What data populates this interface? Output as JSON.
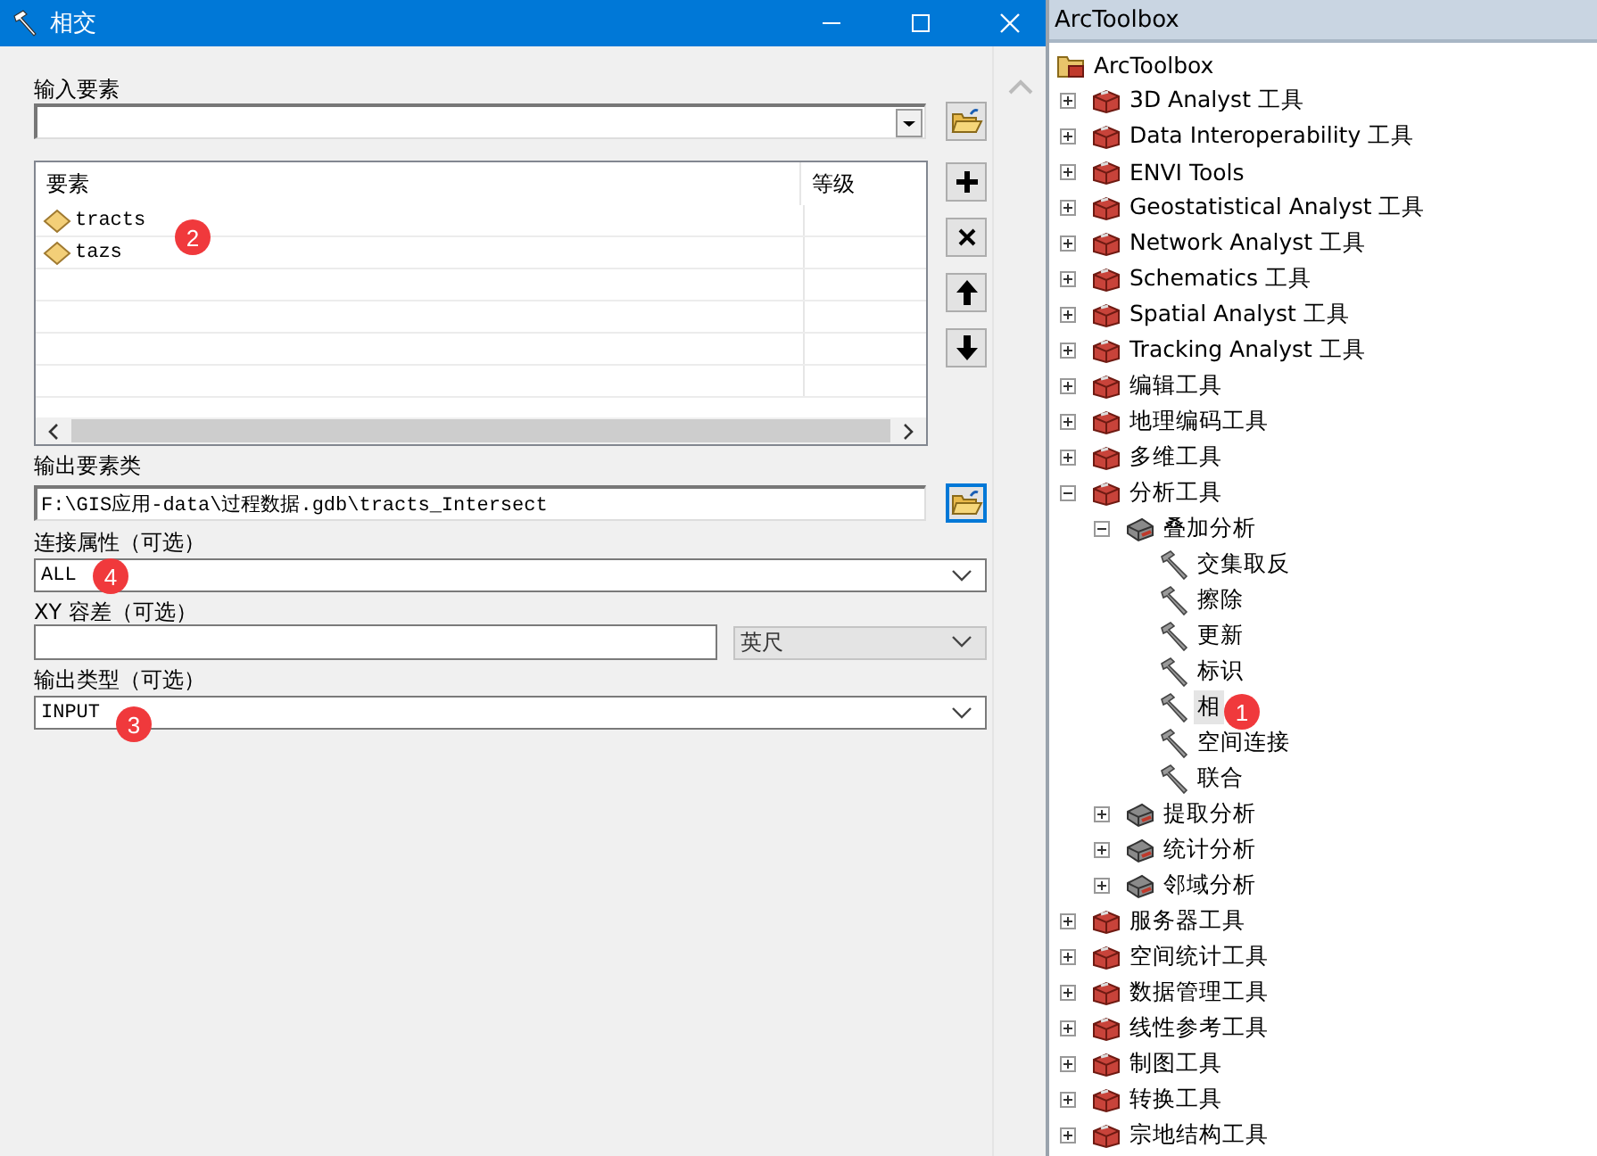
{
  "dialog": {
    "title": "相交",
    "input_features": {
      "label": "输入要素"
    },
    "features_table": {
      "columns": [
        "要素",
        "等级"
      ],
      "badge": "2",
      "rows": [
        {
          "name": "tracts"
        },
        {
          "name": "tazs"
        }
      ]
    },
    "output": {
      "label": "输出要素类",
      "value": "F:\\GIS应用-data\\过程数据.gdb\\tracts_Intersect"
    },
    "join_attributes": {
      "label": "连接属性（可选）",
      "value": "ALL",
      "badge": "4"
    },
    "xy_tolerance": {
      "label": "XY 容差（可选）",
      "unit": "英尺",
      "unit_disabled": true
    },
    "output_type": {
      "label": "输出类型（可选）",
      "value": "INPUT",
      "badge": "3"
    }
  },
  "toolbox": {
    "title": "ArcToolbox",
    "tree": [
      {
        "label": "ArcToolbox",
        "kind": "root",
        "selected": false,
        "children": [
          {
            "label": "3D Analyst 工具",
            "kind": "toolbox",
            "expanded": false,
            "selected": false
          },
          {
            "label": "Data Interoperability 工具",
            "kind": "toolbox",
            "expanded": false,
            "selected": false
          },
          {
            "label": "ENVI Tools",
            "kind": "toolbox",
            "expanded": false,
            "selected": false
          },
          {
            "label": "Geostatistical Analyst 工具",
            "kind": "toolbox",
            "expanded": false,
            "selected": false
          },
          {
            "label": "Network Analyst 工具",
            "kind": "toolbox",
            "expanded": false,
            "selected": false
          },
          {
            "label": "Schematics 工具",
            "kind": "toolbox",
            "expanded": false,
            "selected": false
          },
          {
            "label": "Spatial Analyst 工具",
            "kind": "toolbox",
            "expanded": false,
            "selected": false
          },
          {
            "label": "Tracking Analyst 工具",
            "kind": "toolbox",
            "expanded": false,
            "selected": false
          },
          {
            "label": "编辑工具",
            "kind": "toolbox",
            "expanded": false,
            "selected": false
          },
          {
            "label": "地理编码工具",
            "kind": "toolbox",
            "expanded": false,
            "selected": false
          },
          {
            "label": "多维工具",
            "kind": "toolbox",
            "expanded": false,
            "selected": false
          },
          {
            "label": "分析工具",
            "kind": "toolbox",
            "expanded": true,
            "selected": false,
            "children": [
              {
                "label": "叠加分析",
                "kind": "toolset",
                "expanded": true,
                "selected": false,
                "children": [
                  {
                    "label": "交集取反",
                    "kind": "tool",
                    "selected": false
                  },
                  {
                    "label": "擦除",
                    "kind": "tool",
                    "selected": false
                  },
                  {
                    "label": "更新",
                    "kind": "tool",
                    "selected": false
                  },
                  {
                    "label": "标识",
                    "kind": "tool",
                    "selected": false
                  },
                  {
                    "label": "相",
                    "kind": "tool",
                    "selected": true,
                    "badge": "1"
                  },
                  {
                    "label": "空间连接",
                    "kind": "tool",
                    "selected": false
                  },
                  {
                    "label": "联合",
                    "kind": "tool",
                    "selected": false
                  }
                ]
              },
              {
                "label": "提取分析",
                "kind": "toolset",
                "expanded": false,
                "selected": false
              },
              {
                "label": "统计分析",
                "kind": "toolset",
                "expanded": false,
                "selected": false
              },
              {
                "label": "邻域分析",
                "kind": "toolset",
                "expanded": false,
                "selected": false
              }
            ]
          },
          {
            "label": "服务器工具",
            "kind": "toolbox",
            "expanded": false,
            "selected": false
          },
          {
            "label": "空间统计工具",
            "kind": "toolbox",
            "expanded": false,
            "selected": false
          },
          {
            "label": "数据管理工具",
            "kind": "toolbox",
            "expanded": false,
            "selected": false
          },
          {
            "label": "线性参考工具",
            "kind": "toolbox",
            "expanded": false,
            "selected": false
          },
          {
            "label": "制图工具",
            "kind": "toolbox",
            "expanded": false,
            "selected": false
          },
          {
            "label": "转换工具",
            "kind": "toolbox",
            "expanded": false,
            "selected": false
          },
          {
            "label": "宗地结构工具",
            "kind": "toolbox",
            "expanded": false,
            "selected": false
          }
        ]
      }
    ]
  }
}
